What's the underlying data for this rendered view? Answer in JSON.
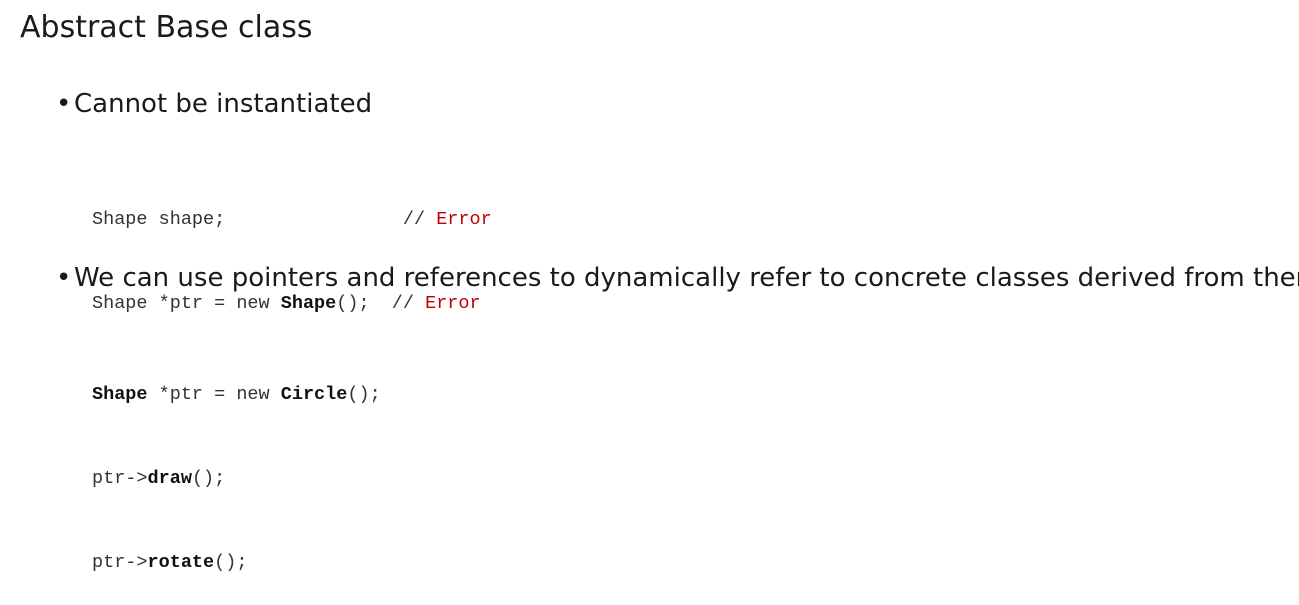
{
  "title": "Abstract Base class",
  "bullets": [
    {
      "text": "Cannot be instantiated",
      "code": [
        {
          "a": "Shape shape;",
          "pad": "                ",
          "comment": "// ",
          "error": "Error"
        },
        {
          "a": "Shape *ptr = new ",
          "bold": "Shape",
          "b": "();",
          "pad": "  ",
          "comment": "// ",
          "error": "Error"
        }
      ]
    },
    {
      "text": "We can use pointers and references to dynamically refer to concrete classes derived from them",
      "code": [
        {
          "bold1": "Shape",
          "a": " *ptr = new ",
          "bold2": "Circle",
          "b": "();"
        },
        {
          "a": "ptr->",
          "bold": "draw",
          "b": "();"
        },
        {
          "a": "ptr->",
          "bold": "rotate",
          "b": "();"
        }
      ]
    }
  ],
  "colors": {
    "error": "#c00000",
    "text": "#1a1a1a",
    "code": "#333333"
  }
}
